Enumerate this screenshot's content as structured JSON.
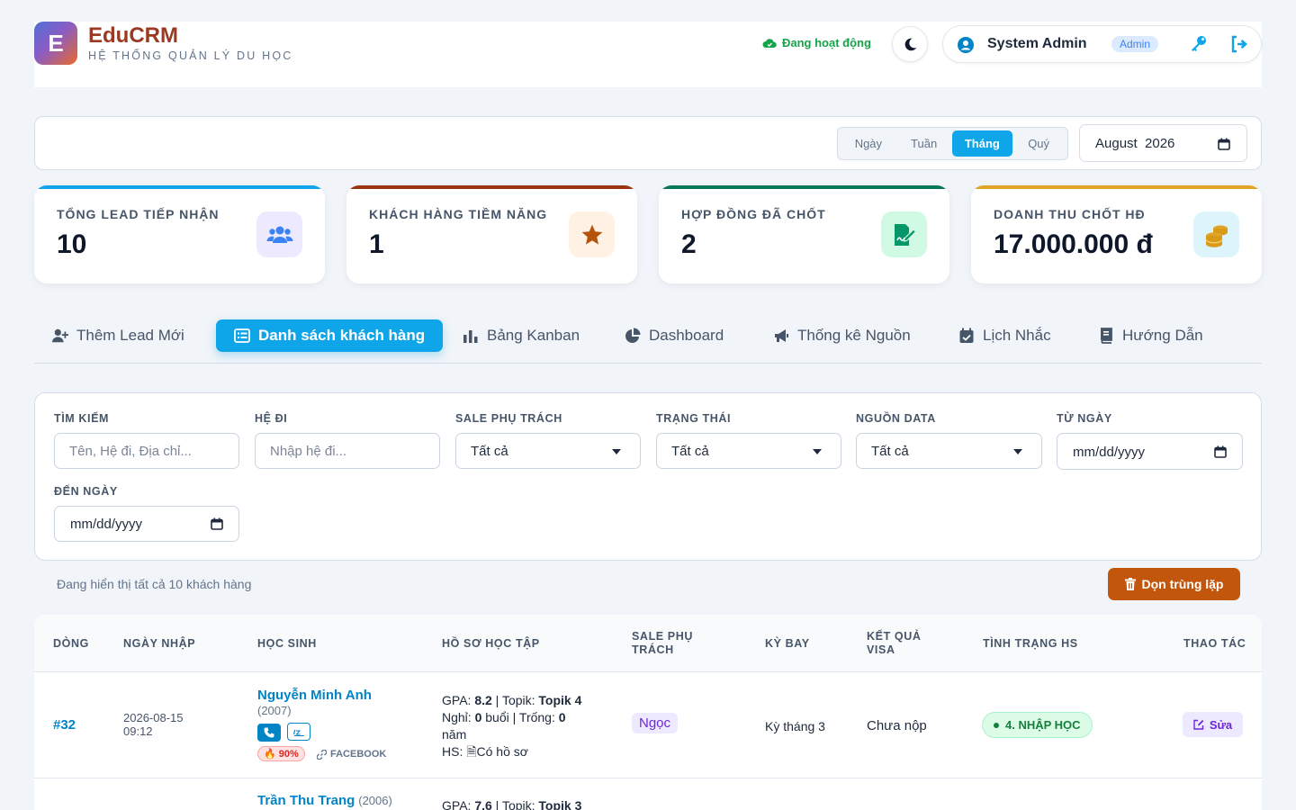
{
  "header": {
    "logo_letter": "E",
    "brand_name": "EduCRM",
    "brand_subtitle": "HỆ THỐNG QUẢN LÝ DU HỌC",
    "status_text": "Đang hoạt động",
    "user_name": "System Admin",
    "user_role": "Admin"
  },
  "period": {
    "options": [
      "Ngày",
      "Tuần",
      "Tháng",
      "Quý"
    ],
    "selected": "Tháng",
    "month_value": "August  2026"
  },
  "stats": [
    {
      "label": "TỔNG LEAD TIẾP NHẬN",
      "value": "10",
      "icon": "users-icon",
      "color": "#3b82f6"
    },
    {
      "label": "KHÁCH HÀNG TIỀM NĂNG",
      "value": "1",
      "icon": "star-icon",
      "color": "#b45309"
    },
    {
      "label": "HỢP ĐỒNG ĐÃ CHỐT",
      "value": "2",
      "icon": "signed-file-icon",
      "color": "#059669"
    },
    {
      "label": "DOANH THU CHỐT HĐ",
      "value": "17.000.000 đ",
      "icon": "coins-icon",
      "color": "#d97706"
    }
  ],
  "tabs": [
    {
      "label": "Thêm Lead Mới",
      "icon": "user-plus-icon"
    },
    {
      "label": "Danh sách khách hàng",
      "icon": "list-icon",
      "active": true
    },
    {
      "label": "Bảng Kanban",
      "icon": "bar-chart-icon"
    },
    {
      "label": "Dashboard",
      "icon": "pie-chart-icon"
    },
    {
      "label": "Thống kê Nguồn",
      "icon": "megaphone-icon"
    },
    {
      "label": "Lịch Nhắc",
      "icon": "calendar-check-icon"
    },
    {
      "label": "Hướng Dẫn",
      "icon": "book-icon"
    }
  ],
  "filters": {
    "search_label": "TÌM KIẾM",
    "search_placeholder": "Tên, Hệ đi, Địa chỉ...",
    "program_label": "HỆ ĐI",
    "program_placeholder": "Nhập hệ đi...",
    "sale_label": "SALE PHỤ TRÁCH",
    "sale_value": "Tất cả",
    "status_label": "TRẠNG THÁI",
    "status_value": "Tất cả",
    "source_label": "NGUỒN DATA",
    "source_value": "Tất cả",
    "from_label": "TỪ NGÀY",
    "from_value": "mm/dd/yyyy",
    "to_label": "ĐẾN NGÀY",
    "to_value": "mm/dd/yyyy"
  },
  "summary": {
    "count_text": "Đang hiển thị tất cả 10 khách hàng",
    "dedupe_label": "Dọn trùng lặp"
  },
  "table": {
    "headers": {
      "row": "DÒNG",
      "date": "NGÀY NHẬP",
      "student": "HỌC SINH",
      "academic": "HỒ SƠ HỌC TẬP",
      "sale_l1": "SALE PHỤ",
      "sale_l2": "TRÁCH",
      "intake": "KỲ BAY",
      "visa_l1": "KẾT QUẢ",
      "visa_l2": "VISA",
      "status": "TÌNH TRẠNG HS",
      "actions": "THAO TÁC"
    },
    "rows": [
      {
        "id": "#32",
        "date": "2026-08-15",
        "time": "09:12",
        "name": "Nguyễn Minh Anh",
        "birth": "(2007)",
        "probability": "90%",
        "source": "FACEBOOK",
        "gpa_label": "GPA:",
        "gpa": "8.2",
        "topik_label": "Topik:",
        "topik": "Topik 4",
        "absent_label": "Nghỉ:",
        "absent": "0",
        "absent_unit": "buổi",
        "gap_label": "Trống:",
        "gap": "0",
        "gap_unit": "năm",
        "docs_label": "HS:",
        "docs": "Có hồ sơ",
        "sale": "Ngọc",
        "intake": "Kỳ tháng 3",
        "visa": "Chưa nộp",
        "status": "4. NHẬP HỌC",
        "edit_label": "Sửa"
      },
      {
        "name": "Trần Thu Trang",
        "birth": "(2006)",
        "gpa_label": "GPA:",
        "gpa": "7.6",
        "topik_label": "Topik:",
        "topik": "Topik 3"
      }
    ]
  }
}
